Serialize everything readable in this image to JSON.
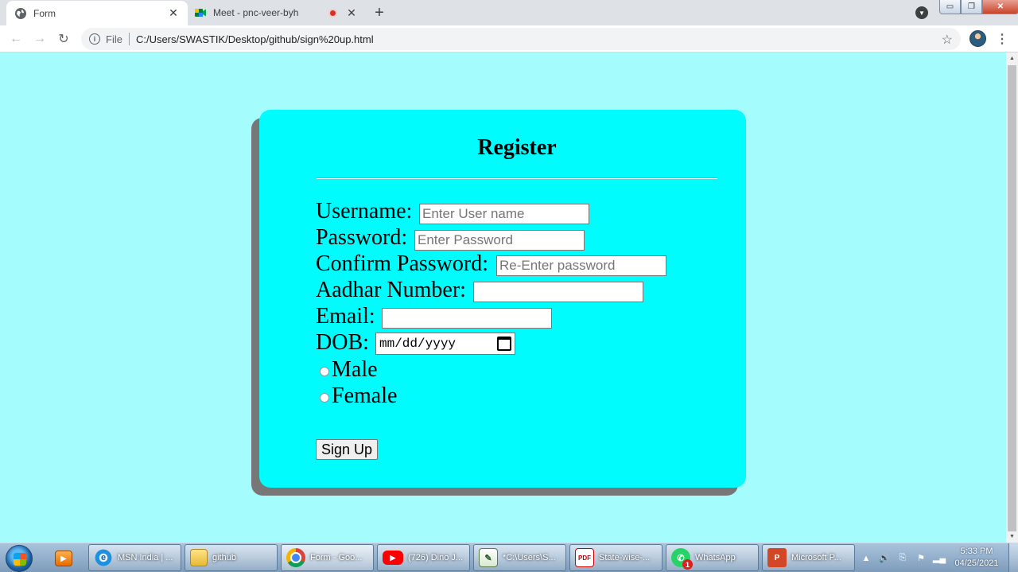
{
  "browser": {
    "tabs": [
      {
        "title": "Form",
        "icon": "globe-icon",
        "close": "✕"
      },
      {
        "title": "Meet - pnc-veer-byh",
        "icon": "google-meet-icon",
        "close": "✕"
      }
    ],
    "new_tab": "+",
    "address": {
      "info": "i",
      "scheme_label": "File",
      "url": "C:/Users/SWASTIK/Desktop/github/sign%20up.html"
    },
    "nav": {
      "back": "←",
      "forward": "→",
      "reload": "↻"
    },
    "bookmark": "☆",
    "menu": "⋮",
    "window_controls": {
      "minimize": "▭",
      "maximize": "❐",
      "close": "✕"
    }
  },
  "form": {
    "title": "Register",
    "fields": {
      "username": {
        "label": "Username:",
        "placeholder": "Enter User name"
      },
      "password": {
        "label": "Password:",
        "placeholder": "Enter Password"
      },
      "confirm": {
        "label": "Confirm Password:",
        "placeholder": "Re-Enter password"
      },
      "aadhar": {
        "label": "Aadhar Number:",
        "placeholder": ""
      },
      "email": {
        "label": "Email:",
        "placeholder": ""
      },
      "dob": {
        "label": "DOB:",
        "value": "mm/dd/yyyy"
      }
    },
    "gender": [
      "Male",
      "Female"
    ],
    "submit": "Sign Up"
  },
  "taskbar": {
    "items": [
      {
        "label": "MSN India | ...",
        "icon": "internet-explorer-icon"
      },
      {
        "label": "github",
        "icon": "folder-icon"
      },
      {
        "label": "Form - Goo...",
        "icon": "chrome-icon"
      },
      {
        "label": "(726) Dino J...",
        "icon": "youtube-icon"
      },
      {
        "label": "*C:\\Users\\S...",
        "icon": "notepad-icon"
      },
      {
        "label": "State-wise-...",
        "icon": "pdf-icon"
      },
      {
        "label": "WhatsApp",
        "icon": "whatsapp-icon",
        "badge": "1"
      },
      {
        "label": "Microsoft P...",
        "icon": "powerpoint-icon"
      }
    ],
    "clock": {
      "time": "5:33 PM",
      "date": "04/25/2021"
    }
  }
}
